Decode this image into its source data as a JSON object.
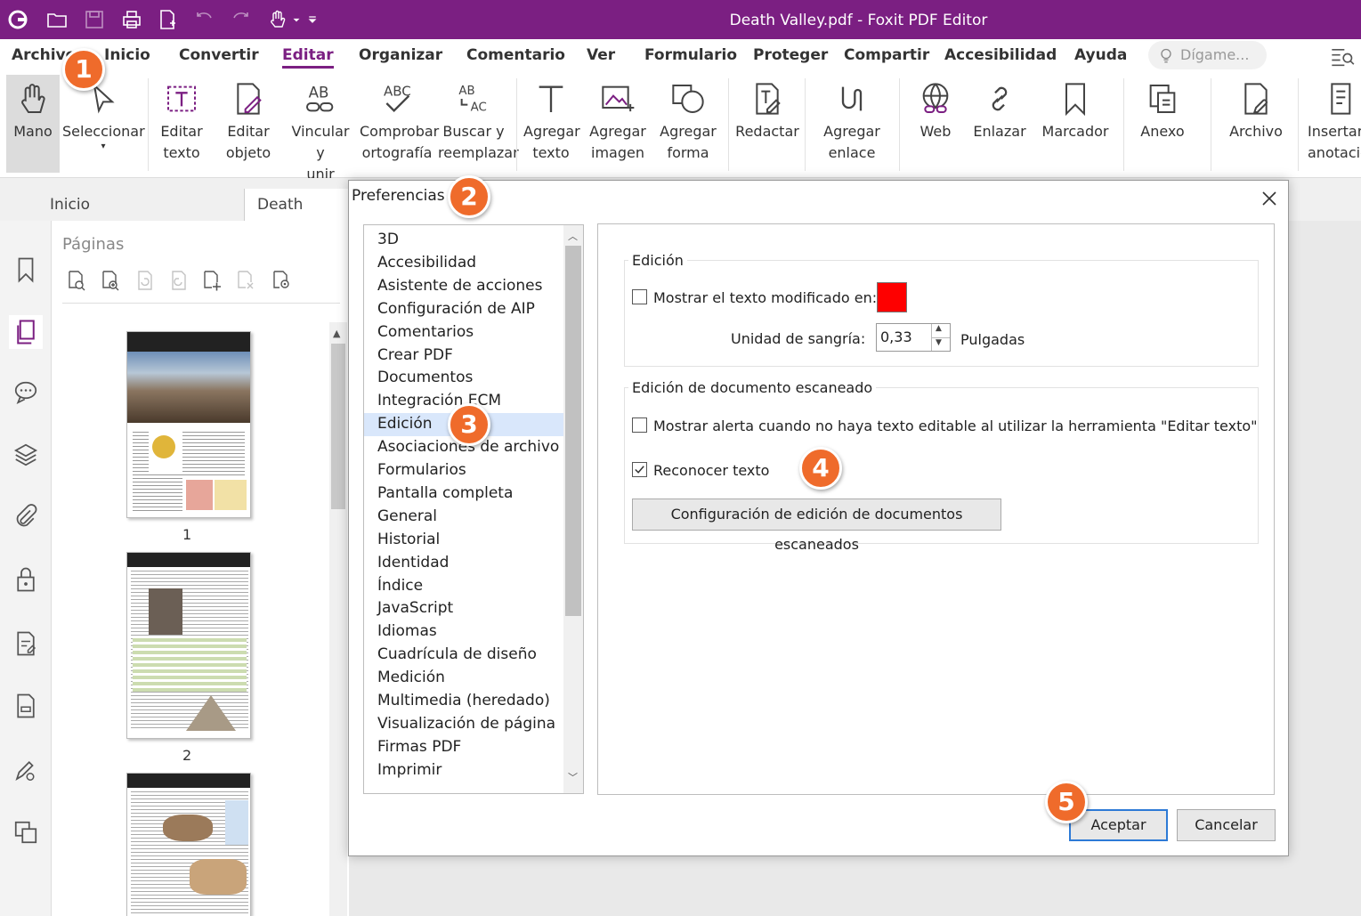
{
  "app": {
    "title": "Death Valley.pdf - Foxit PDF Editor"
  },
  "menu": [
    "Archivo",
    "Inicio",
    "Convertir",
    "Editar",
    "Organizar",
    "Comentario",
    "Ver",
    "Formulario",
    "Proteger",
    "Compartir",
    "Accesibilidad",
    "Ayuda"
  ],
  "tell_me": {
    "placeholder": "Dígame..."
  },
  "ribbon": [
    {
      "label": "Mano",
      "icon": "hand-icon"
    },
    {
      "label": "Seleccionar",
      "icon": "select-cursor-icon"
    },
    {
      "label": "Editar\ntexto",
      "icon": "edit-text-icon"
    },
    {
      "label": "Editar\nobjeto",
      "icon": "edit-object-icon"
    },
    {
      "label": "Vincular y\nunir texto",
      "icon": "link-join-text-icon"
    },
    {
      "label": "Comprobar\nortografía",
      "icon": "spellcheck-icon"
    },
    {
      "label": "Buscar y\nreemplazar",
      "icon": "find-replace-icon"
    },
    {
      "label": "Agregar\ntexto",
      "icon": "add-text-icon"
    },
    {
      "label": "Agregar\nimagen",
      "icon": "add-image-icon"
    },
    {
      "label": "Agregar\nforma",
      "icon": "add-shape-icon"
    },
    {
      "label": "Redactar",
      "icon": "redact-icon"
    },
    {
      "label": "Agregar\nenlace",
      "icon": "add-link-icon"
    },
    {
      "label": "Web",
      "icon": "web-link-icon"
    },
    {
      "label": "Enlazar",
      "icon": "chain-link-icon"
    },
    {
      "label": "Marcador",
      "icon": "bookmark-icon"
    },
    {
      "label": "Anexo",
      "icon": "attachment-icon"
    },
    {
      "label": "Archivo",
      "icon": "file-icon"
    },
    {
      "label": "Insertar\nanotación",
      "icon": "insert-annotation-icon"
    }
  ],
  "tabs": [
    "Inicio",
    "Death Valley..."
  ],
  "pages_panel": {
    "title": "Páginas",
    "page_numbers": [
      "1",
      "2"
    ]
  },
  "dialog": {
    "title": "Preferencias",
    "categories": [
      "3D",
      "Accesibilidad",
      "Asistente de acciones",
      "Configuración de AIP",
      "Comentarios",
      "Crear PDF",
      "Documentos",
      "Integración ECM",
      "Edición",
      "Asociaciones de archivo",
      "Formularios",
      "Pantalla completa",
      "General",
      "Historial",
      "Identidad",
      "Índice",
      "JavaScript",
      "Idiomas",
      "Cuadrícula de diseño",
      "Medición",
      "Multimedia (heredado)",
      "Visualización de página",
      "Firmas PDF",
      "Imprimir"
    ],
    "selected_category": "Edición",
    "group1": {
      "title": "Edición",
      "show_modified_label": "Mostrar el texto modificado en:",
      "show_modified_checked": false,
      "color": "#fe0000",
      "indent_label": "Unidad de sangría:",
      "indent_value": "0,33",
      "indent_unit": "Pulgadas"
    },
    "group2": {
      "title": "Edición de documento escaneado",
      "alert_label": "Mostrar alerta cuando no haya texto editable al utilizar la herramienta \"Editar texto\"",
      "alert_checked": false,
      "recognize_label": "Reconocer texto",
      "recognize_checked": true,
      "settings_button": "Configuración de edición de documentos escaneados"
    },
    "ok": "Aceptar",
    "cancel": "Cancelar"
  },
  "badges": [
    "1",
    "2",
    "3",
    "4",
    "5"
  ]
}
